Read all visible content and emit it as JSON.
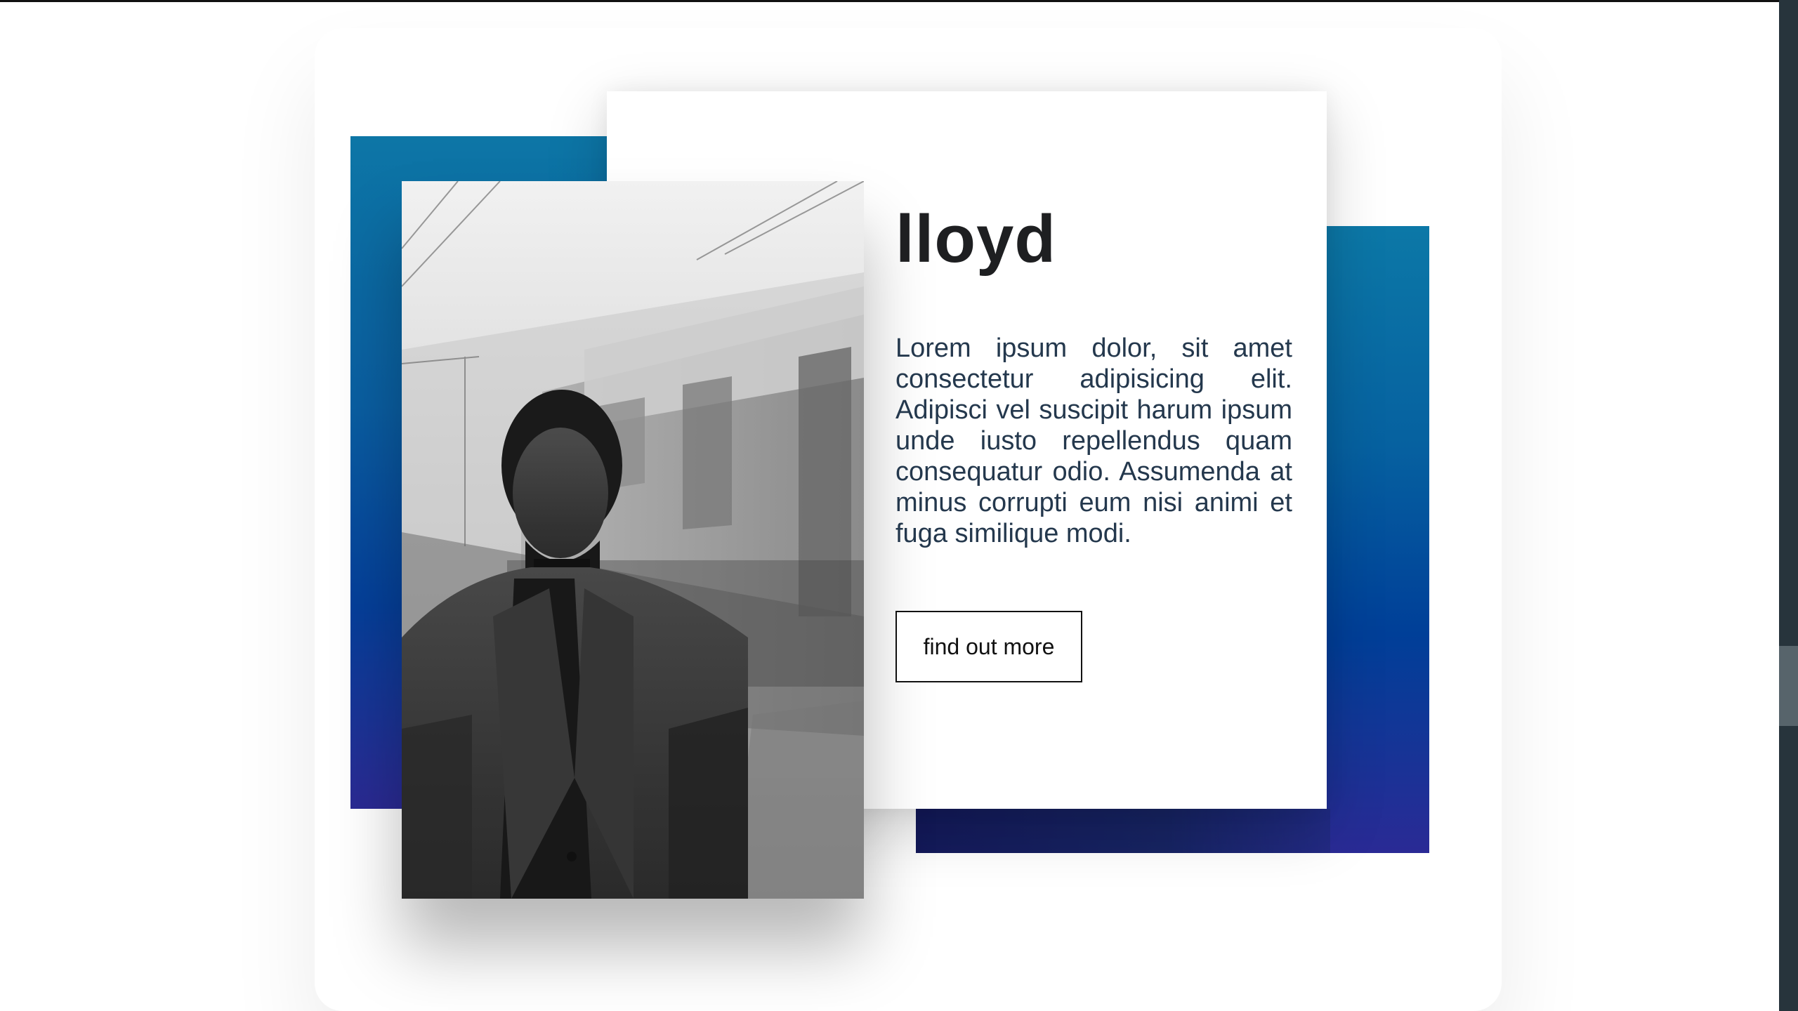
{
  "profile": {
    "name": "lloyd",
    "description": "Lorem ipsum dolor, sit amet consectetur adipisicing elit. Adipisci vel suscipit harum ipsum unde iusto repellendus quam consequatur odio. Assumenda at minus corrupti eum nisi animi et fuga similique modi.",
    "button_label": "find out more"
  },
  "colors": {
    "accent_blue": "#0a5ea1",
    "accent_indigo": "#2b2a93",
    "text_dark": "#1e1f21",
    "body_text": "#24384d",
    "scrollbar": "#27343c",
    "scrollbar_thumb": "#57646b"
  },
  "icons": {
    "portrait": "photo-placeholder"
  }
}
